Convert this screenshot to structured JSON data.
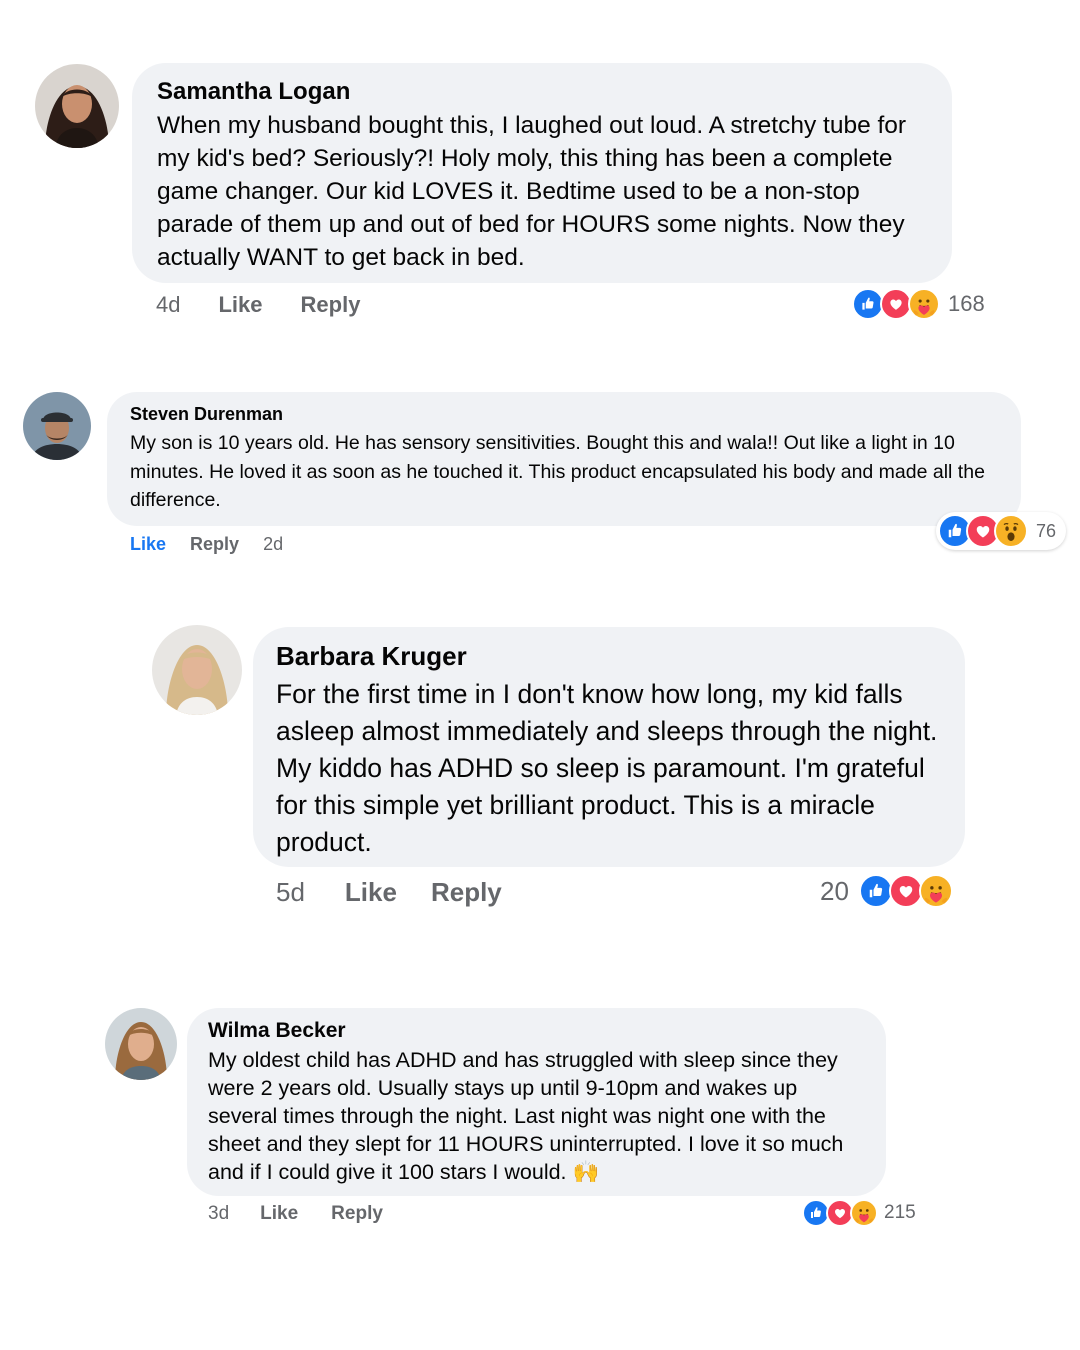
{
  "comments": [
    {
      "author": "Samantha Logan",
      "text": "When my husband bought this, I laughed out loud. A stretchy tube for my kid's bed? Seriously?! Holy moly, this thing has been a complete game changer. Our kid LOVES it. Bedtime used to be a non-stop parade of them up and out of bed for HOURS some nights. Now they actually WANT to get back in bed.",
      "time": "4d",
      "like_label": "Like",
      "reply_label": "Reply",
      "reactions": [
        "like-icon",
        "love-icon",
        "care-icon"
      ],
      "reaction_count": "168"
    },
    {
      "author": "Steven Durenman",
      "text": "My son is 10 years old. He has sensory sensitivities. Bought this and wala!! Out like a light in 10 minutes. He loved it as soon as he touched it. This product encapsulated his body and made all the difference.",
      "time": "2d",
      "like_label": "Like",
      "reply_label": "Reply",
      "reactions": [
        "like-icon",
        "love-icon",
        "wow-icon"
      ],
      "reaction_count": "76"
    },
    {
      "author": "Barbara Kruger",
      "text": "For the first time in I don't know how long, my kid falls asleep almost immediately and sleeps through the night. My kiddo has ADHD so sleep is paramount. I'm grateful for this simple yet brilliant product. This is a miracle product.",
      "time": "5d",
      "like_label": "Like",
      "reply_label": "Reply",
      "reactions": [
        "like-icon",
        "love-icon",
        "care-icon"
      ],
      "reaction_count": "20"
    },
    {
      "author": "Wilma Becker",
      "text": "My oldest child has ADHD and has struggled with sleep since they were 2 years old. Usually stays up until 9-10pm and wakes up several times through the night. Last night was night one with the sheet and they slept for 11 HOURS uninterrupted. I love it so much and if I could give it 100 stars I would. 🙌",
      "time": "3d",
      "like_label": "Like",
      "reply_label": "Reply",
      "reactions": [
        "like-icon",
        "love-icon",
        "care-icon"
      ],
      "reaction_count": "215"
    }
  ],
  "colors": {
    "bubble": "#f0f2f5",
    "meta_text": "#65676b",
    "like_blue": "#1877f2",
    "love_red": "#f33e58",
    "care_yellow": "#f7b125"
  }
}
